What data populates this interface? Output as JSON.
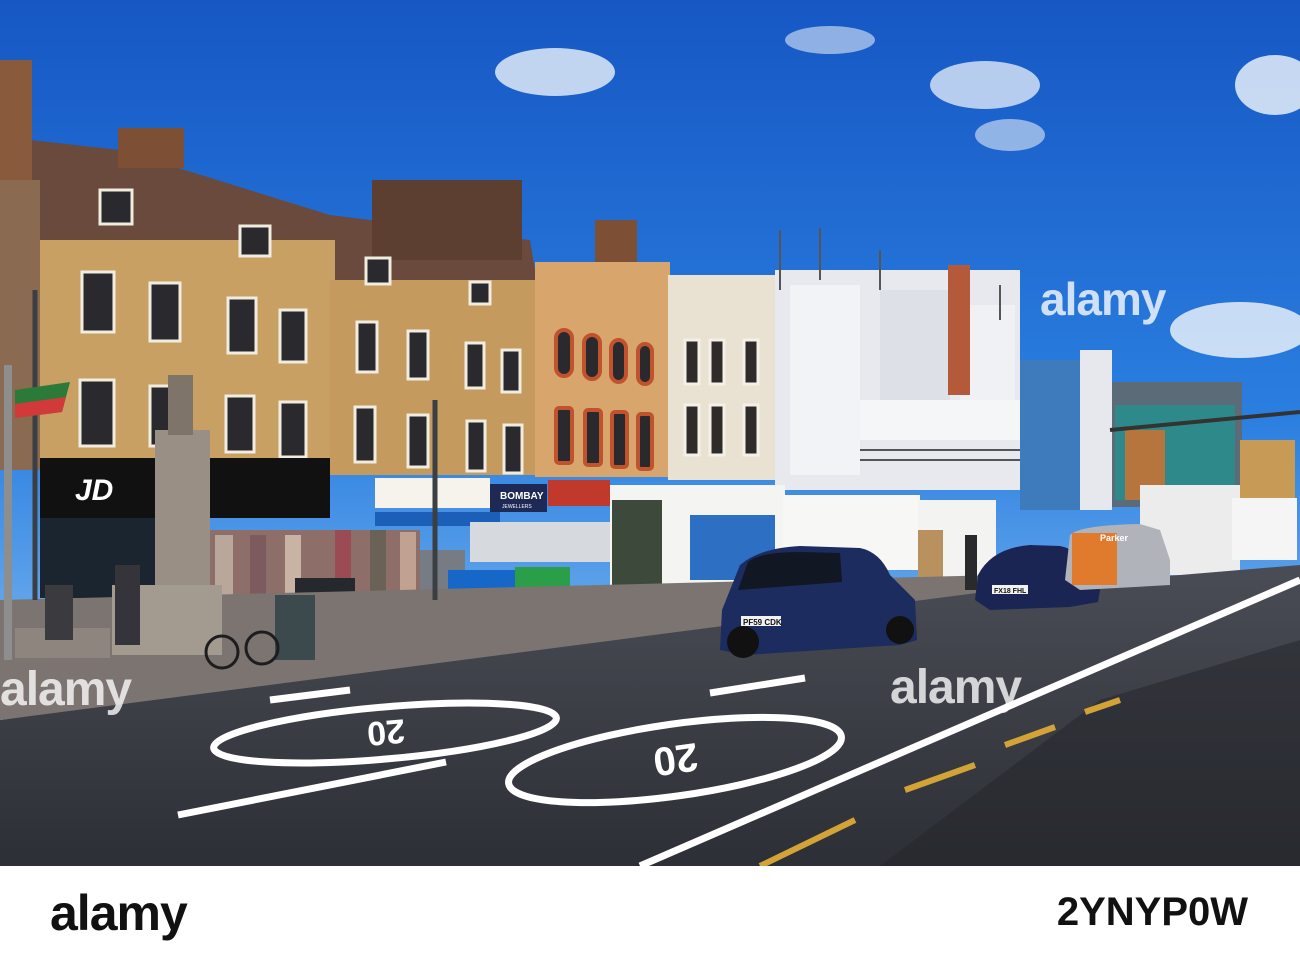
{
  "photo": {
    "shop_signs": {
      "jd": "JD",
      "bombay": "BOMBAY",
      "bombay_sub": "JEWELLERS"
    },
    "number_plates": {
      "hatchback": "PF59 CDK",
      "sedan": "FX18 FHL"
    },
    "van_brand": "Parker",
    "road_marking": "20"
  },
  "watermarks": {
    "main": "alamy",
    "left": "alamy",
    "center": "alamy"
  },
  "footer": {
    "logo": "alamy",
    "image_id": "2YNYP0W"
  },
  "colors": {
    "sky": "#1e6fd0",
    "brick": "#c9a064",
    "road": "#3a3d44"
  }
}
